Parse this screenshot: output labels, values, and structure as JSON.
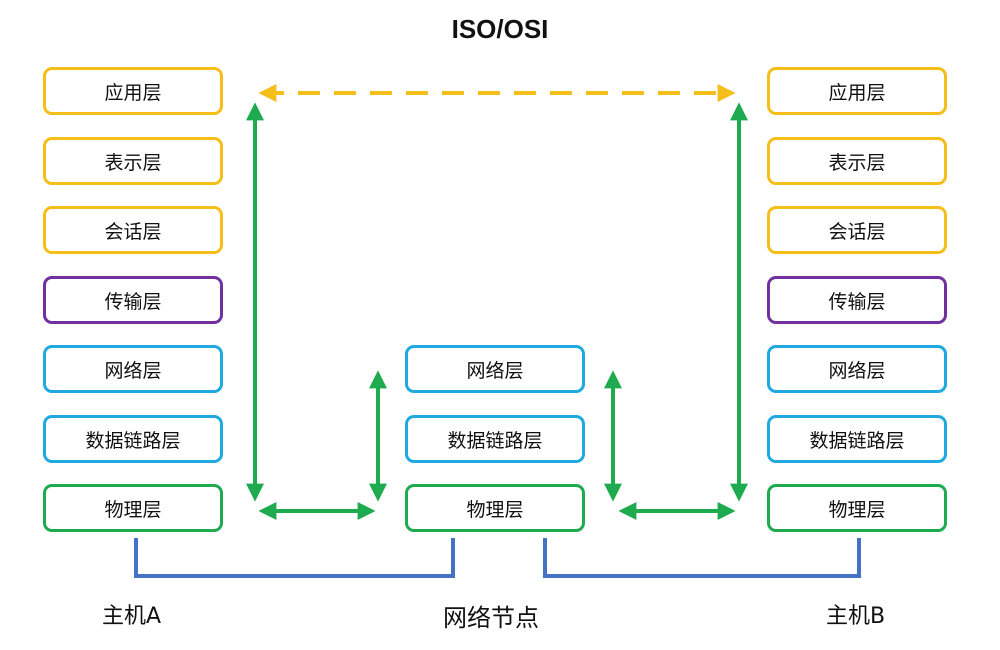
{
  "title": "ISO/OSI",
  "hostA": {
    "label": "主机A",
    "layers": [
      "应用层",
      "表示层",
      "会话层",
      "传输层",
      "网络层",
      "数据链路层",
      "物理层"
    ]
  },
  "node": {
    "label": "网络节点",
    "layers": [
      "网络层",
      "数据链路层",
      "物理层"
    ]
  },
  "hostB": {
    "label": "主机B",
    "layers": [
      "应用层",
      "表示层",
      "会话层",
      "传输层",
      "网络层",
      "数据链路层",
      "物理层"
    ]
  },
  "colors": {
    "application": "#F5BE19",
    "transport": "#7030A0",
    "network": "#1FA9E1",
    "physical": "#1EAA4E",
    "link_line": "#4472C4"
  }
}
